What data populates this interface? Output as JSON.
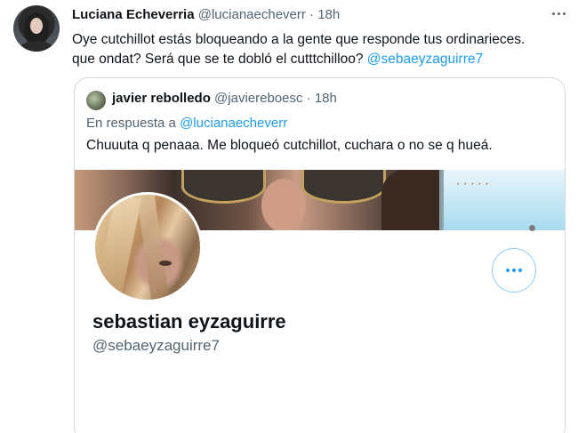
{
  "tweet": {
    "author_name": "Luciana Echeverria",
    "author_handle": "@lucianaecheverr",
    "separator": "·",
    "time": "18h",
    "text_line1": "Oye cutchillot estás bloqueando a la gente que responde tus ordinarieces.",
    "text_line2_prefix": "que ondat? Será que se te dobló el cutttchilloo? ",
    "mention": "@sebaeyzaguirre7",
    "more_icon": "more-horizontal-icon"
  },
  "quote": {
    "author_name": "javier rebolledo",
    "author_handle": "@javiereboesc",
    "separator": "·",
    "time": "18h",
    "reply_prefix": "En respuesta a ",
    "reply_to": "@lucianaecheverr",
    "text": "Chuuuta q penaaa. Me bloqueó cutchillot, cuchara o no se q hueá."
  },
  "profile_card": {
    "name": "sebastian eyzaguirre",
    "handle": "@sebaeyzaguirre7",
    "more_icon": "more-horizontal-icon"
  },
  "colors": {
    "link": "#1d9bf0",
    "secondary_text": "#536471",
    "border": "#cfd9de"
  }
}
